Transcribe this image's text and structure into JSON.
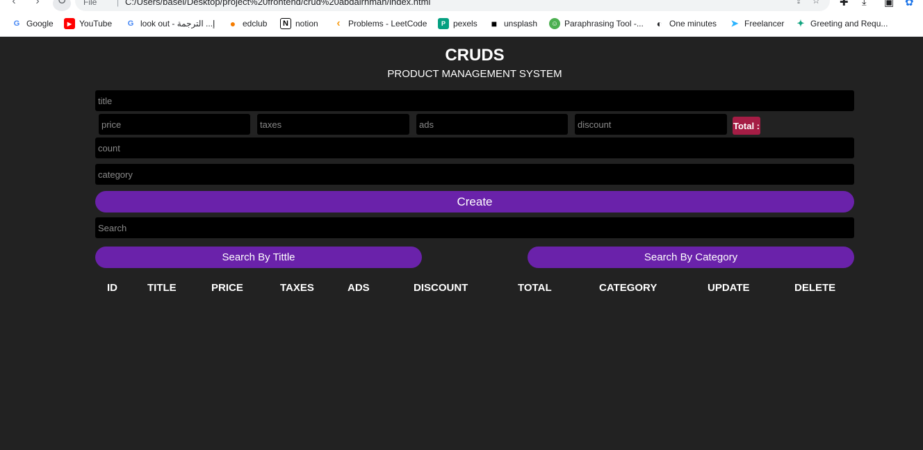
{
  "browser": {
    "nav_back": "‹",
    "nav_forward": "›",
    "nav_reload": "↻",
    "info_label": "File",
    "url": "C:/Users/basel/Desktop/project%20frontend/crud%20abdalrhman/index.html",
    "bookmarks": [
      {
        "label": "Google",
        "icon": "G",
        "color": "#4285f4"
      },
      {
        "label": "YouTube",
        "icon": "▶",
        "color": "#ff0000"
      },
      {
        "label": "look out - إ... الترجمة",
        "icon": "G",
        "color": "#4285f4"
      },
      {
        "label": "edclub",
        "icon": "●",
        "color": "#f57c00"
      },
      {
        "label": "notion",
        "icon": "N",
        "color": "#000000"
      },
      {
        "label": "Problems - LeetCode",
        "icon": "‹",
        "color": "#f89f1b"
      },
      {
        "label": "pexels",
        "icon": "P",
        "color": "#05a081"
      },
      {
        "label": "unsplash",
        "icon": "■",
        "color": "#000000"
      },
      {
        "label": "Paraphrasing Tool -...",
        "icon": "☺",
        "color": "#4caf50"
      },
      {
        "label": "One minutes",
        "icon": "◐",
        "color": "#202124"
      },
      {
        "label": "Freelancer",
        "icon": "➤",
        "color": "#29b2fe"
      },
      {
        "label": "Greeting and Requ...",
        "icon": "✦",
        "color": "#10a37f"
      }
    ]
  },
  "app": {
    "title": "CRUDS",
    "subtitle": "PRODUCT MANAGEMENT SYSTEM",
    "form": {
      "title_placeholder": "title",
      "price_placeholder": "price",
      "taxes_placeholder": "taxes",
      "ads_placeholder": "ads",
      "discount_placeholder": "discount",
      "total_label": "Total :",
      "count_placeholder": "count",
      "category_placeholder": "category",
      "create_label": "Create"
    },
    "search": {
      "placeholder": "Search",
      "by_title_label": "Search By Tittle",
      "by_category_label": "Search By Category"
    },
    "table": {
      "headers": [
        "ID",
        "TITLE",
        "PRICE",
        "TAXES",
        "ADS",
        "DISCOUNT",
        "TOTAL",
        "CATEGORY",
        "UPDATE",
        "DELETE"
      ]
    }
  }
}
